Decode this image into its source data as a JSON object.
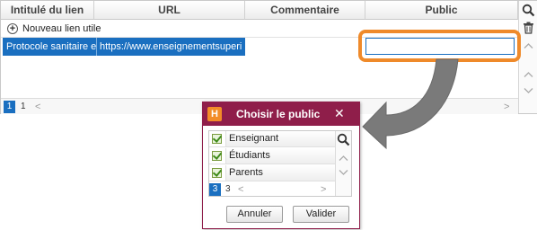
{
  "grid": {
    "columns": [
      {
        "label": "Intitulé du lien"
      },
      {
        "label": "URL"
      },
      {
        "label": "Commentaire"
      },
      {
        "label": "Public"
      }
    ],
    "new_link_label": "Nouveau lien utile",
    "selected_row": {
      "title": "Protocole sanitaire e",
      "url": "https://www.enseignementsuperi",
      "public": ""
    },
    "pagination": {
      "current": "1",
      "total": "1"
    }
  },
  "dialog": {
    "logo": "H",
    "title": "Choisir le public",
    "close_glyph": "✕",
    "options": [
      {
        "label": "Enseignant",
        "checked": true
      },
      {
        "label": "Étudiants",
        "checked": true
      },
      {
        "label": "Parents",
        "checked": true
      }
    ],
    "pagination": {
      "current": "3",
      "total": "3"
    },
    "cancel_label": "Annuler",
    "confirm_label": "Valider"
  },
  "colors": {
    "selection": "#1a6fc0",
    "highlight": "#ef8a2a",
    "dialog_title": "#8f1e4a",
    "check": "#3f8a1a"
  },
  "icons": [
    "search-icon",
    "trash-icon",
    "plus-circle-icon",
    "chevron-up-icon",
    "chevron-down-icon",
    "chevron-left-icon",
    "chevron-right-icon",
    "close-icon",
    "curved-arrow-icon"
  ]
}
